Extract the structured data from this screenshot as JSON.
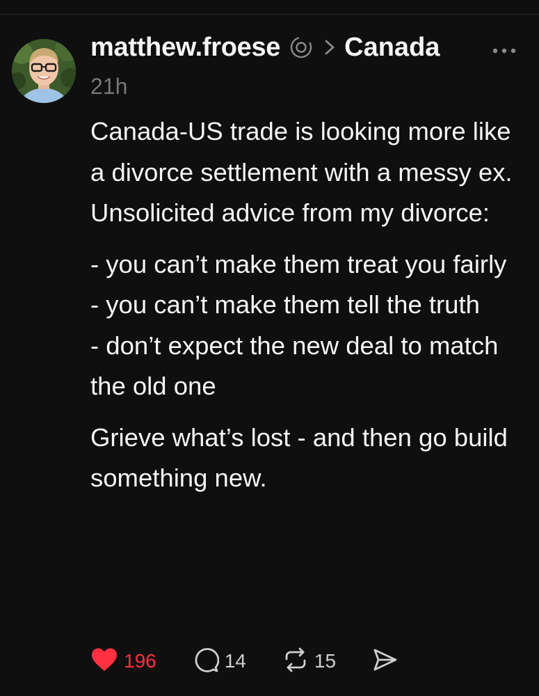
{
  "post": {
    "author": "matthew.froese",
    "community": "Canada",
    "timestamp": "21h",
    "paragraphs": [
      "Canada-US trade is looking more like a divorce settlement with a messy ex. Unsolicited advice from my divorce:",
      "- you can’t make them treat you fairly",
      "- you can’t make them tell the truth",
      "- don’t expect the new deal to match the old one",
      "Grieve what’s lost - and then go build something new."
    ]
  },
  "actions": {
    "likes": "196",
    "replies": "14",
    "reposts": "15"
  },
  "icons": {
    "author_badge": "threads-badge-icon",
    "separator": "chevron-right-icon",
    "more": "more-options-icon",
    "like": "heart-filled-icon",
    "reply": "comment-icon",
    "repost": "repost-icon",
    "share": "send-icon"
  },
  "colors": {
    "background": "#0f0f10",
    "text": "#f3f5f7",
    "secondary_text": "#77777b",
    "like_accent": "#ff3040"
  }
}
